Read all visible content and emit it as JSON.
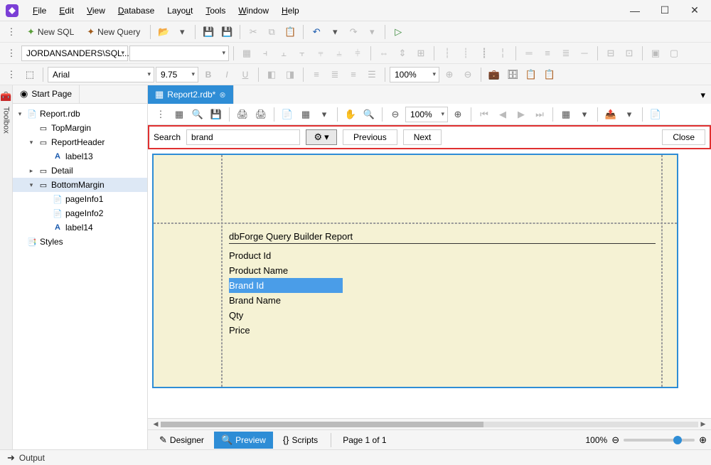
{
  "menu": {
    "file": "File",
    "edit": "Edit",
    "view": "View",
    "database": "Database",
    "layout": "Layout",
    "tools": "Tools",
    "window": "Window",
    "help": "Help"
  },
  "win": {
    "min": "—",
    "max": "☐",
    "close": "✕"
  },
  "tb1": {
    "newsql": "New SQL",
    "newquery": "New Query",
    "undo_drop": "▾",
    "redo_drop": "▾"
  },
  "combos": {
    "conn": "JORDANSANDERS\\SQL...",
    "font": "Arial",
    "size": "9.75",
    "zoom": "100%",
    "preview_zoom": "100%"
  },
  "sidebar": {
    "label": "Toolbox"
  },
  "tabs": {
    "start": "Start Page",
    "report": "Report2.rdb*"
  },
  "tree": {
    "root": "Report.rdb",
    "topmargin": "TopMargin",
    "rheader": "ReportHeader",
    "label13": "label13",
    "detail": "Detail",
    "bmargin": "BottomMargin",
    "pinfo1": "pageInfo1",
    "pinfo2": "pageInfo2",
    "label14": "label14",
    "styles": "Styles"
  },
  "search": {
    "label": "Search",
    "value": "brand",
    "prev": "Previous",
    "next": "Next",
    "close": "Close"
  },
  "report": {
    "title": "dbForge Query Builder Report",
    "f1": "Product Id",
    "f2": "Product Name",
    "f3": "Brand Id",
    "f4": "Brand Name",
    "f5": "Qty",
    "f6": "Price"
  },
  "bottom": {
    "designer": "Designer",
    "preview": "Preview",
    "scripts": "Scripts",
    "page": "Page 1 of 1",
    "zoom": "100%"
  },
  "status": {
    "output": "Output"
  }
}
